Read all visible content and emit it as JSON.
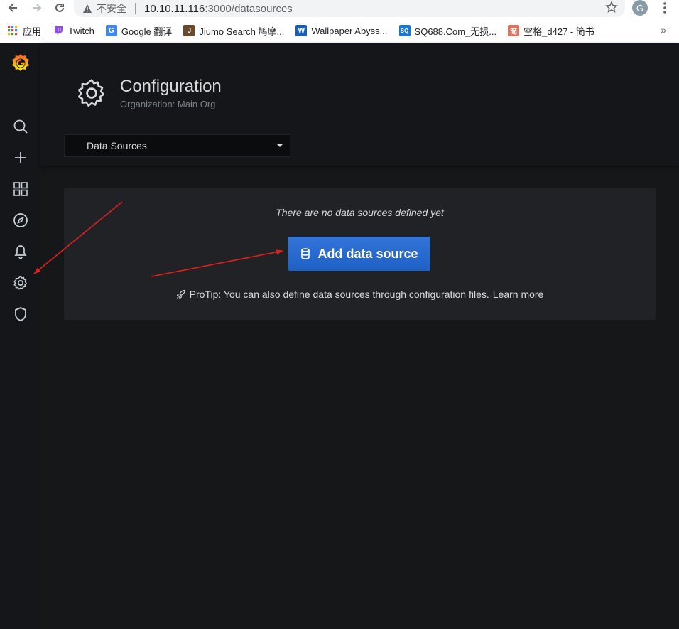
{
  "browser": {
    "url_warning": "不安全",
    "url_host": "10.10.11.116",
    "url_path": ":3000/datasources",
    "profile_initial": "G"
  },
  "bookmarks": [
    {
      "label": "应用",
      "icon": "apps-grid-icon",
      "color": "#4285f4"
    },
    {
      "label": "Twitch",
      "icon": "twitch-icon",
      "color": "#9146ff"
    },
    {
      "label": "Google 翻译",
      "icon": "google-translate-icon",
      "color": "#4285f4"
    },
    {
      "label": "Jiumo Search 鸠摩...",
      "icon": "jiumo-icon",
      "color": "#6b4a2b",
      "glyph": "J"
    },
    {
      "label": "Wallpaper Abyss...",
      "icon": "wallpaper-abyss-icon",
      "color": "#1a5fb4",
      "glyph": "W"
    },
    {
      "label": "SQ688.Com_无损...",
      "icon": "sq688-icon",
      "color": "#1976d2",
      "glyph": "SQ"
    },
    {
      "label": "空格_d427 - 简书",
      "icon": "jianshu-icon",
      "color": "#ea6f5a",
      "glyph": "简"
    }
  ],
  "bookmarks_more": "»",
  "header": {
    "title": "Configuration",
    "subtitle": "Organization: Main Org.",
    "nav_select_value": "Data Sources"
  },
  "empty_state": {
    "message": "There are no data sources defined yet",
    "button_label": "Add data source",
    "protip_text": "ProTip: You can also define data sources through configuration files.",
    "protip_link": "Learn more"
  },
  "colors": {
    "accent_blue": "#3274d9",
    "annotation_red": "#e0201d"
  }
}
